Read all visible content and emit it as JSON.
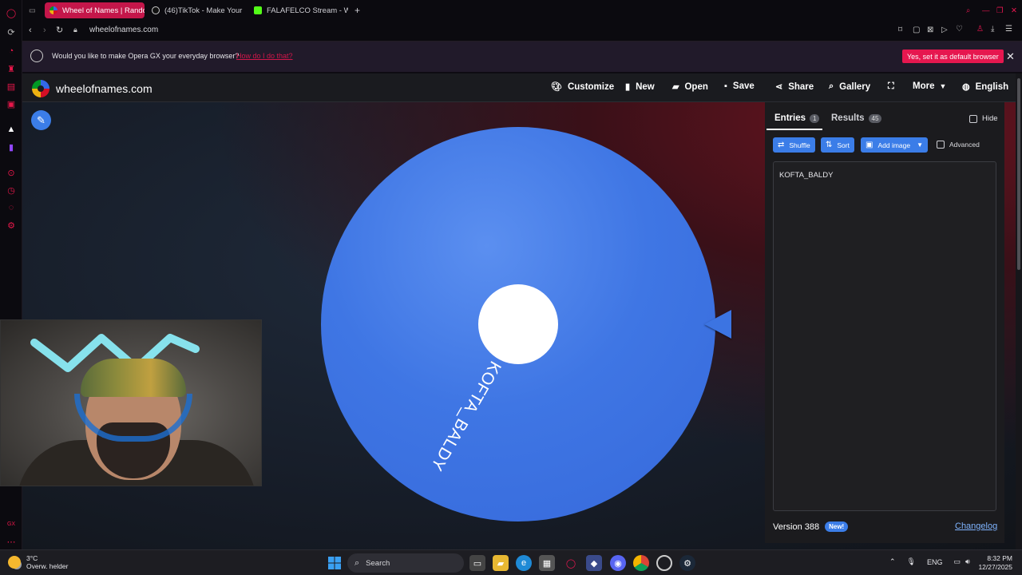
{
  "browser": {
    "tabs": [
      {
        "title": "Wheel of Names | Random",
        "active": true,
        "icon": "wheel-favicon"
      },
      {
        "title": "(46)TikTok - Make Your D",
        "active": false,
        "icon": "tiktok-favicon"
      },
      {
        "title": "FALAFELCO Stream - Wat",
        "active": false,
        "icon": "kick-favicon"
      }
    ],
    "new_tab_label": "+",
    "url": "wheelofnames.com"
  },
  "notification": {
    "text": "Would you like to make Opera GX your everyday browser?",
    "link": "How do I do that?",
    "button": "Yes, set it as default browser"
  },
  "site": {
    "brand": "wheelofnames.com",
    "menu": {
      "customize": "Customize",
      "new": "New",
      "open": "Open",
      "save": "Save",
      "share": "Share",
      "gallery": "Gallery",
      "more": "More",
      "language": "English"
    }
  },
  "wheel": {
    "label": "KOFTA_BALDY",
    "color": "#3f76e4"
  },
  "panel": {
    "entries_tab": "Entries",
    "entries_count": "1",
    "results_tab": "Results",
    "results_count": "45",
    "hide_label": "Hide",
    "shuffle": "Shuffle",
    "sort": "Sort",
    "add_image": "Add image",
    "advanced": "Advanced",
    "entries_text": "KOFTA_BALDY",
    "version": "Version 388",
    "new_badge": "New!",
    "changelog": "Changelog"
  },
  "taskbar": {
    "weather_temp": "3°C",
    "weather_desc": "Overw. helder",
    "search": "Search",
    "language": "ENG",
    "time": "8:32 PM",
    "date": "12/27/2025"
  },
  "colors": {
    "accent": "#3b7de8",
    "opera_red": "#e6174f"
  }
}
